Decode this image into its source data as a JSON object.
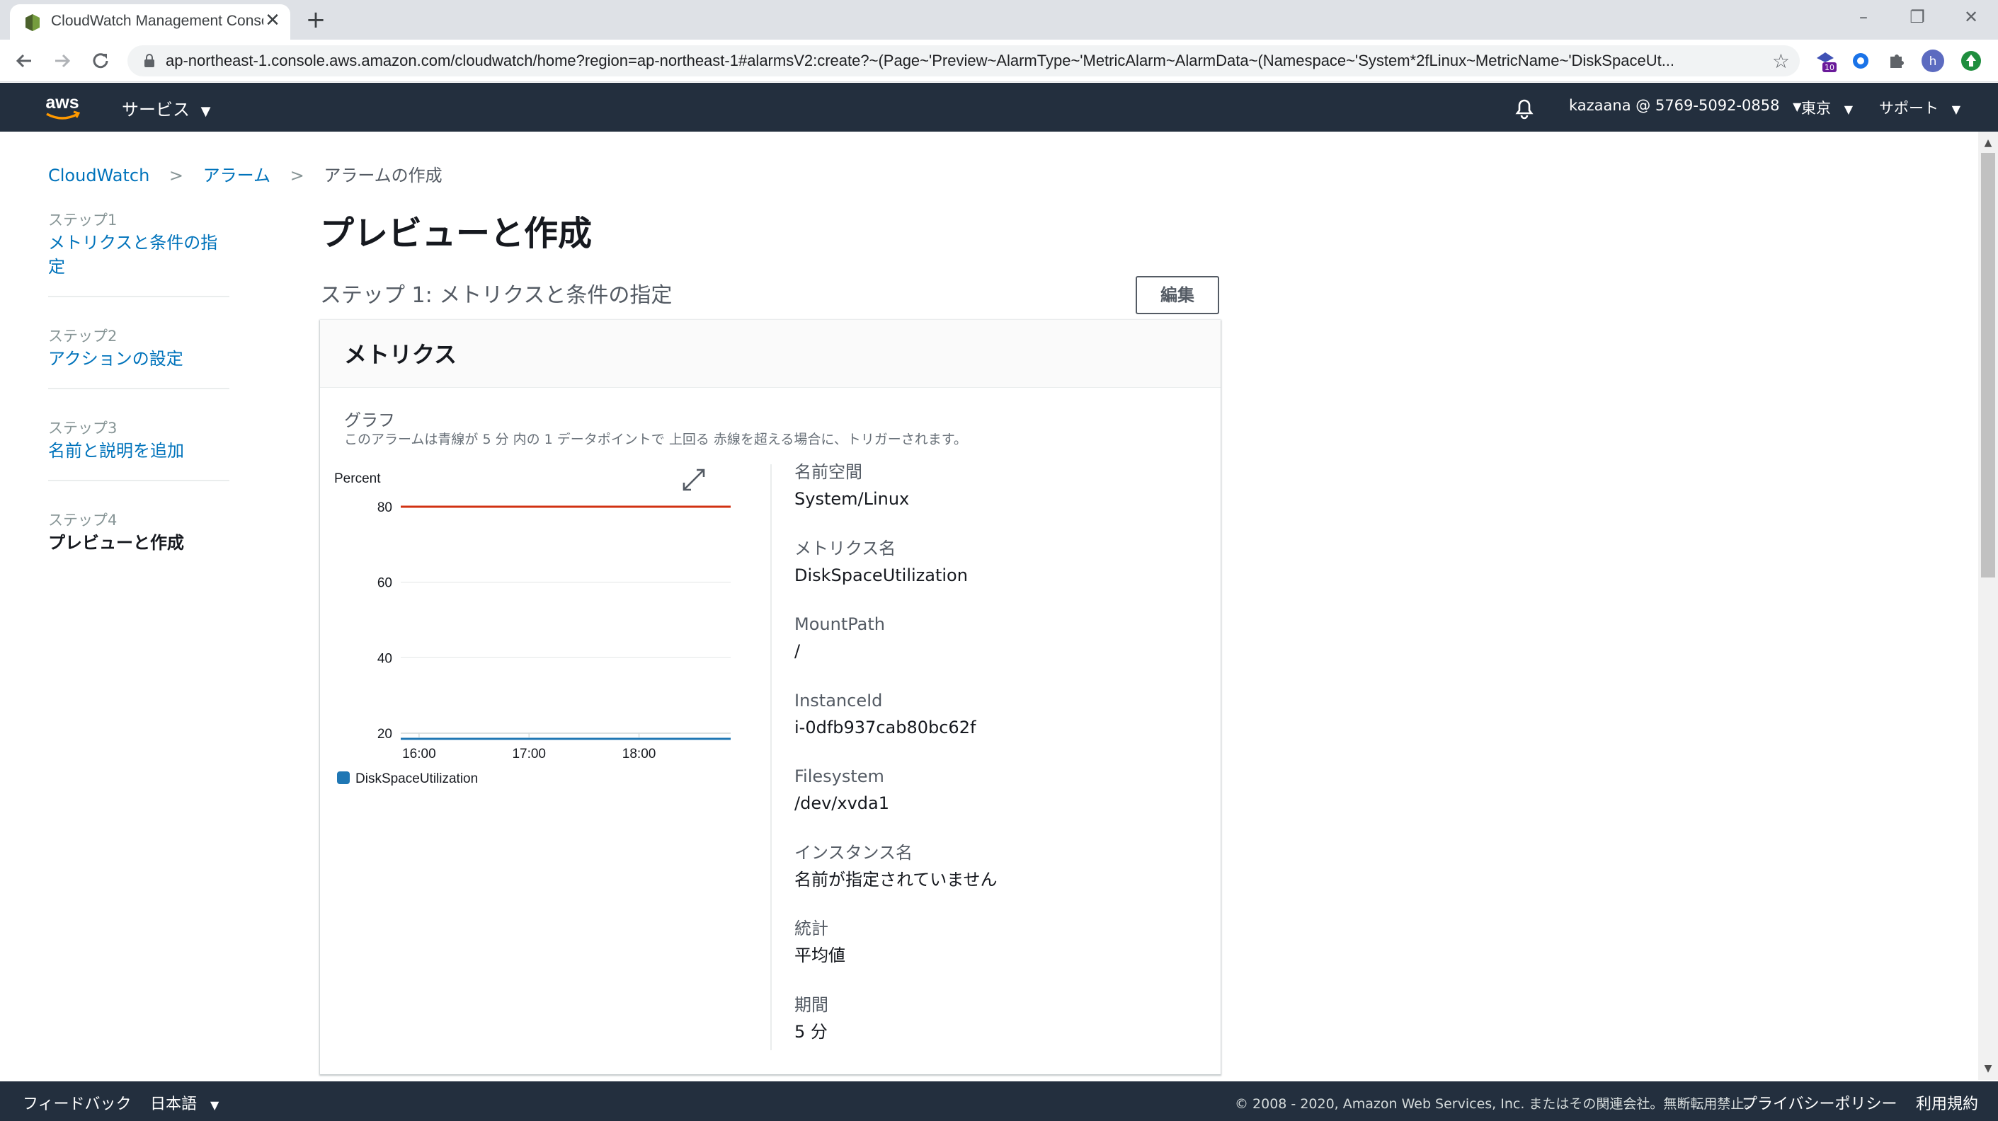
{
  "browser": {
    "tab_title": "CloudWatch Management Conso",
    "url": "ap-northeast-1.console.aws.amazon.com/cloudwatch/home?region=ap-northeast-1#alarmsV2:create?~(Page~'Preview~AlarmType~'MetricAlarm~AlarmData~(Namespace~'System*2fLinux~MetricName~'DiskSpaceUt...",
    "extension_badge": "10",
    "profile_initial": "h"
  },
  "aws_header": {
    "services_label": "サービス",
    "account": "kazaana @ 5769-5092-0858",
    "region": "東京",
    "support": "サポート"
  },
  "breadcrumb": {
    "items": [
      "CloudWatch",
      "アラーム",
      "アラームの作成"
    ]
  },
  "steps": [
    {
      "num": "ステップ1",
      "label": "メトリクスと条件の指定"
    },
    {
      "num": "ステップ2",
      "label": "アクションの設定"
    },
    {
      "num": "ステップ3",
      "label": "名前と説明を追加"
    },
    {
      "num": "ステップ4",
      "label": "プレビューと作成"
    }
  ],
  "main": {
    "page_title": "プレビューと作成",
    "section_title": "ステップ 1: メトリクスと条件の指定",
    "edit_label": "編集",
    "panel_title": "メトリクス",
    "graph_label": "グラフ",
    "graph_desc": "このアラームは青線が 5 分 内の 1 データポイントで 上回る 赤線を超える場合に、トリガーされます。"
  },
  "details": [
    {
      "key": "名前空間",
      "value": "System/Linux"
    },
    {
      "key": "メトリクス名",
      "value": "DiskSpaceUtilization"
    },
    {
      "key": "MountPath",
      "value": "/"
    },
    {
      "key": "InstanceId",
      "value": "i-0dfb937cab80bc62f"
    },
    {
      "key": "Filesystem",
      "value": "/dev/xvda1"
    },
    {
      "key": "インスタンス名",
      "value": "名前が指定されていません"
    },
    {
      "key": "統計",
      "value": "平均値"
    },
    {
      "key": "期間",
      "value": "5 分"
    }
  ],
  "footer": {
    "feedback": "フィードバック",
    "language": "日本語",
    "copyright": "© 2008 - 2020, Amazon Web Services, Inc. またはその関連会社。無断転用禁止。",
    "privacy": "プライバシーポリシー",
    "terms": "利用規約"
  },
  "colors": {
    "aws_header": "#232f3e",
    "link": "#0073bb",
    "threshold_line": "#d13212",
    "metric_line": "#1f77b4"
  },
  "chart_data": {
    "type": "line",
    "ylabel": "Percent",
    "ylim": [
      20,
      80
    ],
    "yticks": [
      80,
      60,
      40,
      20
    ],
    "xticks": [
      "16:00",
      "17:00",
      "18:00"
    ],
    "grid": true,
    "legend_position": "bottom-left",
    "series": [
      {
        "name": "DiskSpaceUtilization",
        "x": [
          "15:50",
          "18:50"
        ],
        "values": [
          18.5,
          18.5
        ],
        "color": "#1f77b4"
      },
      {
        "x": [
          "15:50",
          "18:50"
        ],
        "values": [
          80,
          80
        ],
        "color": "#d13212"
      }
    ]
  }
}
